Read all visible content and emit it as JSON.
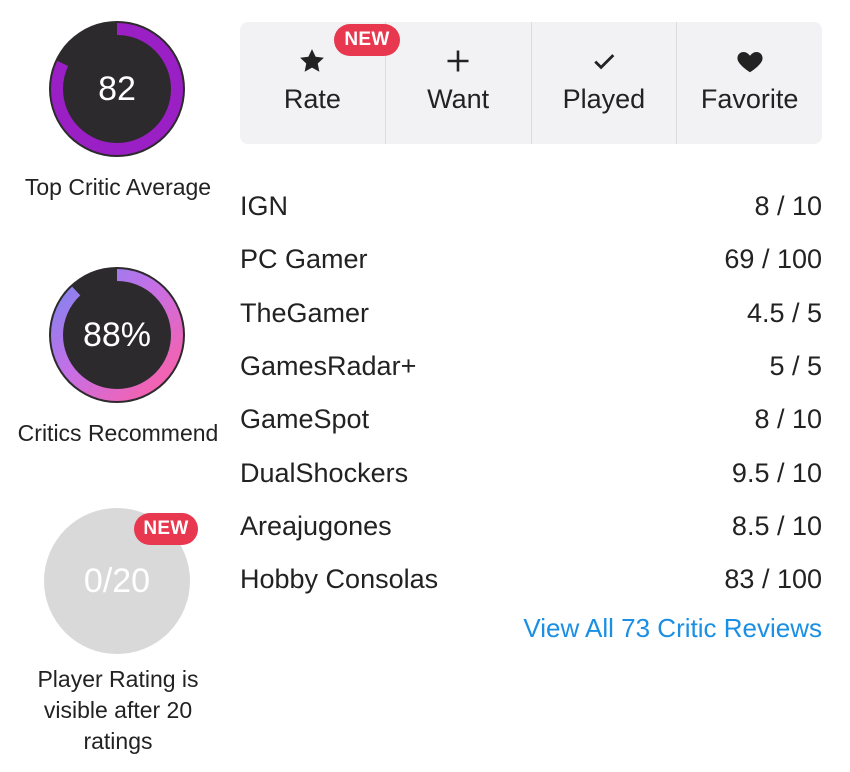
{
  "scores": {
    "top_critic": {
      "value": "82",
      "caption": "Top Critic Average",
      "ring_color": "#9a1fc4"
    },
    "critics_recommend": {
      "value": "88%",
      "caption": "Critics Recommend"
    },
    "player_rating": {
      "value": "0/20",
      "caption": "Player Rating is visible after 20 ratings",
      "badge": "NEW"
    }
  },
  "actions": [
    {
      "label": "Rate",
      "icon": "star-icon",
      "badge": "NEW"
    },
    {
      "label": "Want",
      "icon": "plus-icon"
    },
    {
      "label": "Played",
      "icon": "checkmark-icon"
    },
    {
      "label": "Favorite",
      "icon": "heart-icon"
    }
  ],
  "reviews": [
    {
      "outlet": "IGN",
      "score": "8 / 10"
    },
    {
      "outlet": "PC Gamer",
      "score": "69 / 100"
    },
    {
      "outlet": "TheGamer",
      "score": "4.5 / 5"
    },
    {
      "outlet": "GamesRadar+",
      "score": "5 / 5"
    },
    {
      "outlet": "GameSpot",
      "score": "8 / 10"
    },
    {
      "outlet": "DualShockers",
      "score": "9.5 / 10"
    },
    {
      "outlet": "Areajugones",
      "score": "8.5 / 10"
    },
    {
      "outlet": "Hobby Consolas",
      "score": "83 / 100"
    }
  ],
  "view_all": "View All 73 Critic Reviews",
  "colors": {
    "accent_link": "#1a8fe3",
    "badge": "#e8384f",
    "ring_dark": "#2d2a2e"
  }
}
